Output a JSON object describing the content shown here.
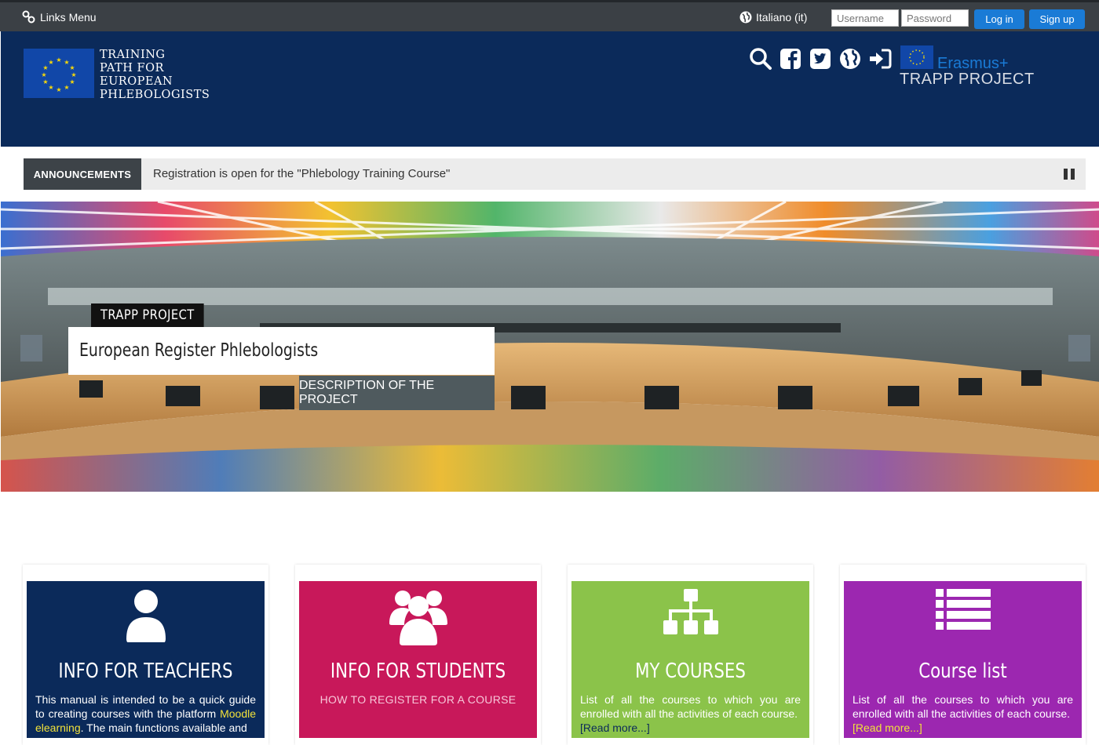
{
  "topbar": {
    "links_menu": "Links Menu",
    "language": "Italiano (it)",
    "username_placeholder": "Username",
    "password_placeholder": "Password",
    "login_label": "Log in",
    "signup_label": "Sign up"
  },
  "header": {
    "logo_lines": [
      "TRAINING",
      "PATH FOR",
      "EUROPEAN",
      "PHLEBOLOGISTS"
    ],
    "erasmus": "Erasmus+",
    "project": "TRAPP PROJECT",
    "icons": [
      "search-icon",
      "facebook-icon",
      "twitter-icon",
      "globe-icon",
      "login-icon"
    ]
  },
  "announcements": {
    "label": "ANNOUNCEMENTS",
    "text": "Registration is open for the \"Phlebology Training Course\""
  },
  "hero": {
    "tag": "TRAPP PROJECT",
    "title": "European Register Phlebologists",
    "button": "DESCRIPTION OF THE PROJECT"
  },
  "cards": [
    {
      "title": "INFO FOR TEACHERS",
      "color": "#0b2a5a",
      "icon": "user-icon",
      "text_a": "This manual is intended to be a quick guide to creating courses with the platform ",
      "text_hl": "Moodle elearning",
      "text_b": ". The main functions available and"
    },
    {
      "title": "INFO FOR STUDENTS",
      "color": "#c8185a",
      "icon": "users-icon",
      "subtitle": "HOW TO REGISTER FOR A COURSE"
    },
    {
      "title": "MY COURSES",
      "color": "#8bc34a",
      "icon": "sitemap-icon",
      "text": "List of all the courses to which you are enrolled with all the activities of each course.",
      "read_more": "[Read more...]"
    },
    {
      "title": "Course list",
      "color": "#9c27b0",
      "icon": "list-icon",
      "text": "List of all the courses to which you are enrolled with all the activities of each course.",
      "read_more": "[Read more...]"
    }
  ]
}
